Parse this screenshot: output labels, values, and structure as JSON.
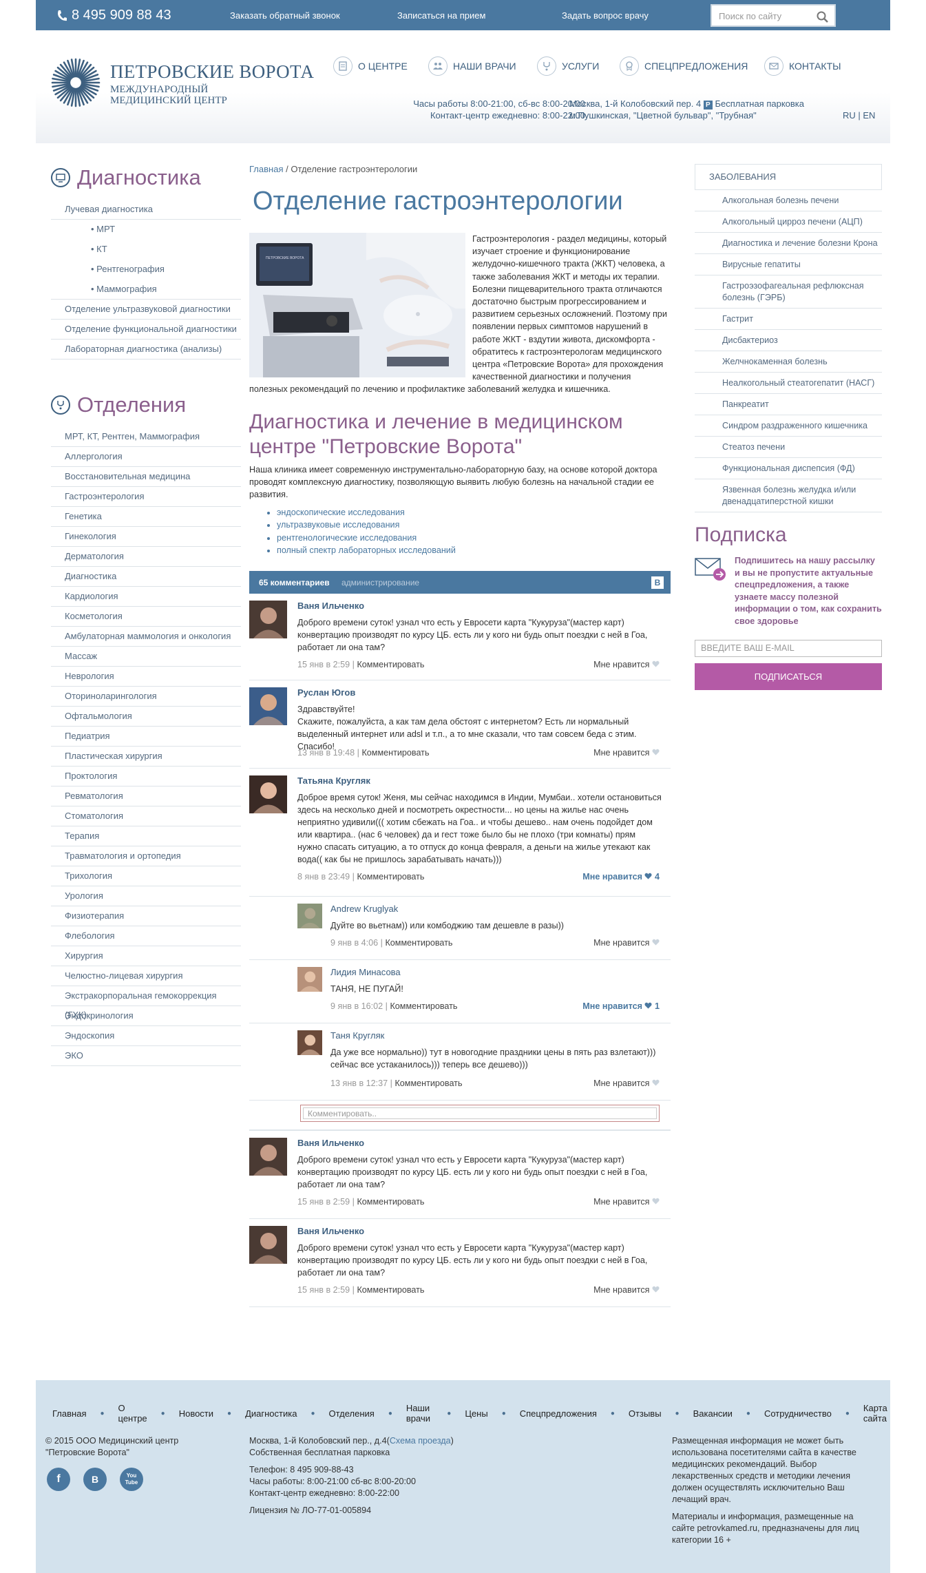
{
  "topbar": {
    "phone": "8 495 909 88 43",
    "links": [
      "Заказать обратный звонок",
      "Записаться на прием",
      "Задать вопрос врачу"
    ],
    "search_placeholder": "Поиск по сайту"
  },
  "logo": {
    "line1": "ПЕТРОВСКИЕ ВОРОТА",
    "line2": "МЕЖДУНАРОДНЫЙ",
    "line3": "МЕДИЦИНСКИЙ ЦЕНТР"
  },
  "nav": [
    "О ЦЕНТРЕ",
    "НАШИ ВРАЧИ",
    "УСЛУГИ",
    "СПЕЦПРЕДЛОЖЕНИЯ",
    "КОНТАКТЫ"
  ],
  "header_info": {
    "hours1": "Часы работы 8:00-21:00, сб-вс 8:00-20:00",
    "hours2": "Контакт-центр ежедневно: 8:00-22:00",
    "address1": "Москва, 1-й Колобовский пер. 4",
    "parking": "Бесплатная парковка",
    "address2": "м.Пушкинская, \"Цветной бульвар\", \"Трубная\"",
    "parking_icon": "P",
    "lang": "RU | EN"
  },
  "left": {
    "diag_title": "Диагностика",
    "diag_items": [
      "Лучевая диагностика",
      "• МРТ",
      "• КТ",
      "• Рентгенография",
      "• Маммография",
      "Отделение ультразвуковой диагностики",
      "Отделение функциональной диагностики",
      "Лабораторная диагностика (анализы)"
    ],
    "dept_title": "Отделения",
    "dept_items": [
      "МРТ, КТ, Рентген, Маммография",
      "Аллергология",
      "Восстановительная медицина",
      "Гастроэнтерология",
      "Генетика",
      "Гинекология",
      "Дерматология",
      "Диагностика",
      "Кардиология",
      "Косметология",
      "Амбулаторная маммология и онкология",
      "Массаж",
      "Неврология",
      "Оториноларингология",
      "Офтальмология",
      "Педиатрия",
      "Пластическая хирургия",
      "Проктология",
      "Ревматология",
      "Стоматология",
      "Терапия",
      "Травматология и ортопедия",
      "Трихология",
      "Урология",
      "Физиотерапия",
      "Флебология",
      "Хирургия",
      "Челюстно-лицевая хирургия",
      "Экстракорпоральная гемокоррекция (ГХК)",
      "Эндокринология",
      "Эндоскопия",
      "ЭКО"
    ]
  },
  "main": {
    "crumb_home": "Главная",
    "crumb_sep": " / ",
    "crumb_current": "Отделение гастроэнтерологии",
    "title": "Отделение гастроэнтерологии",
    "intro": "Гастроэнтерология - раздел медицины, который изучает строение и функционирование желудочно-кишечного тракта (ЖКТ) человека, а также заболевания ЖКТ и методы их терапии. Болезни пищеварительного тракта отличаются достаточно быстрым прогрессированием и развитием серьезных осложнений. Поэтому при появлении первых симптомов нарушений в работе ЖКТ - вздутии живота, дискомфорта - обратитесь к гастроэнтерологам медицинского центра «Петровские Ворота» для прохождения качественной диагностики и получения полезных рекомендаций по лечению и профилактике заболеваний желудка и кишечника.",
    "subtitle": "Диагностика и лечение в медицинском центре \"Петровские Ворота\"",
    "para": "Наша клиника имеет современную инструментально-лабораторную базу, на основе которой доктора проводят комплексную диагностику, позволяющую выявить любую болезнь на начальной стадии ее развития.",
    "list": [
      "эндоскопические исследования",
      "ультразвуковые исследования",
      "рентгенологические исследования",
      "полный спектр лабораторных исследований"
    ]
  },
  "comments": {
    "count": "65 комментариев",
    "admin": "администрирование",
    "vk": "В",
    "reply_label": "Комментировать",
    "like_label": "Мне нравится",
    "reply_placeholder": "Комментировать..",
    "items": [
      {
        "name": "Ваня Ильченко",
        "text": "Доброго времени суток! узнал что есть у Евросети карта \"Кукуруза\"(мастер карт) конвертацию производят по курсу ЦБ. есть ли у кого ни будь опыт поездки с ней в Гоа, работает ли она там?",
        "date": "15 янв в 2:59",
        "likes": ""
      },
      {
        "name": "Руслан Югов",
        "text": "Здравствуйте!\nСкажите, пожалуйста, а как там дела обстоят с интернетом? Есть ли нормальный выделенный интернет или adsl и т.п., а то мне сказали, что там совсем беда с этим. Спасибо!",
        "date": "13 янв в 19:48",
        "likes": ""
      },
      {
        "name": "Татьяна Кругляк",
        "text": "Доброе время суток! Женя, мы сейчас находимся в Индии, Мумбаи.. хотели остановиться здесь на несколько дней и посмотреть окрестности... но цены на жилье нас очень неприятно удивили((( хотим сбежать на Гоа.. и чтобы дешево.. нам очень подойдет дом или квартира.. (нас 6 человек) да и гест тоже было бы не плохо (три комнаты) прям нужно спасать ситуацию, а то отпуск до конца февраля, а деньги на жилье утекают как вода(( как бы не пришлось зарабатывать начать)))",
        "date": "8 янв в 23:49",
        "likes": "4"
      },
      {
        "name": "Andrew Kruglyak",
        "text": "Дуйте во вьетнам)) или комбоджию там дешевле в разы))",
        "date": "9 янв в 4:06",
        "likes": ""
      },
      {
        "name": "Лидия Минасова",
        "text": "ТАНЯ, НЕ ПУГАЙ!",
        "date": "9 янв в 16:02",
        "likes": "1"
      },
      {
        "name": "Таня Кругляк",
        "text": "Да уже все нормально)) тут в новогодние праздники цены в пять раз взлетают))) сейчас все устаканилось))) теперь все дешево)))",
        "date": "13 янв в 12:37",
        "likes": ""
      },
      {
        "name": "Ваня Ильченко",
        "text": "Доброго времени суток! узнал что есть у Евросети карта \"Кукуруза\"(мастер карт) конвертацию производят по курсу ЦБ. есть ли у кого ни будь опыт поездки с ней в Гоа, работает ли она там?",
        "date": "15 янв в 2:59",
        "likes": ""
      },
      {
        "name": "Ваня Ильченко",
        "text": "Доброго времени суток! узнал что есть у Евросети карта \"Кукуруза\"(мастер карт) конвертацию производят по курсу ЦБ. есть ли у кого ни будь опыт поездки с ней в Гоа, работает ли она там?",
        "date": "15 янв в 2:59",
        "likes": ""
      }
    ]
  },
  "right": {
    "head": "ЗАБОЛЕВАНИЯ",
    "items": [
      "Алкогольная болезнь печени",
      "Алкогольный цирроз печени (АЦП)",
      "Диагностика и лечение болезни Крона",
      "Вирусные гепатиты",
      "Гастроэзофагеальная рефлюксная болезнь (ГЭРБ)",
      "Гастрит",
      "Дисбактериоз",
      "Желчнокаменная болезнь",
      "Неалкогольный стеатогепатит (НАСГ)",
      "Панкреатит",
      "Синдром раздраженного кишечника",
      "Стеатоз печени",
      "Функциональная диспепсия (ФД)",
      "Язвенная болезнь желудка и/или двенадцатиперстной кишки"
    ],
    "subs_title": "Подписка",
    "subs_text": "Подпишитесь на нашу рассылку и вы не пропустите актуальные спецпредложения, а также узнаете массу полезной информации о том, как сохранить свое здоровье",
    "email_placeholder": "ВВЕДИТЕ ВАШ E-MAIL",
    "button": "ПОДПИСАТЬСЯ"
  },
  "footer": {
    "nav": [
      "Главная",
      "О центре",
      "Новости",
      "Диагностика",
      "Отделения",
      "Наши врачи",
      "Цены",
      "Спецпредложения",
      "Отзывы",
      "Вакансии",
      "Сотрудничество",
      "Карта сайта"
    ],
    "copyright1": "© 2015 ООО Медицинский центр",
    "copyright2": "\"Петровские Ворота\"",
    "addr": "Москва, 1-й Колобовский пер., д.4",
    "map_link": "Схема проезда",
    "parking": "Собственная бесплатная парковка",
    "phone": "Телефон: 8 495 909-88-43",
    "hours": "Часы работы: 8:00-21:00 сб-вс 8:00-20:00",
    "cc": "Контакт-центр ежедневно: 8:00-22:00",
    "license": "Лицензия № ЛО-77-01-005894",
    "disclaimer1": "Размещенная информация не может быть использована посетителями сайта в качестве медицинских рекомендаций. Выбор лекарственных средств и методики лечения должен осуществлять исключительно Ваш лечащий врач.",
    "disclaimer2": "Материалы и информация, размещенные на сайте petrovkamed.ru, предназначены для лиц категории 16 +",
    "social": [
      "f",
      "В",
      "You Tube"
    ]
  },
  "colors": {
    "primary": "#4a78a0",
    "accent": "#8a5f8c",
    "button": "#b45aa6"
  }
}
